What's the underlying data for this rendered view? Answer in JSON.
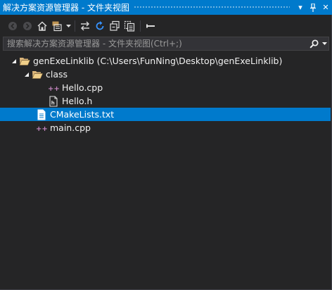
{
  "window": {
    "title": "解决方案资源管理器 - 文件夹视图",
    "dropdown_glyph": "▾",
    "pin_glyph": "ᛘ",
    "close_glyph": "✕"
  },
  "search": {
    "placeholder": "搜索解决方案资源管理器 - 文件夹视图(Ctrl+;)",
    "value": ""
  },
  "tree": {
    "root": {
      "label": "genExeLinklib (C:\\Users\\FunNing\\Desktop\\genExeLinklib)"
    },
    "folder_class": {
      "label": "class"
    },
    "hello_cpp": {
      "label": "Hello.cpp"
    },
    "hello_h": {
      "label": "Hello.h"
    },
    "cmakelists": {
      "label": "CMakeLists.txt",
      "selected": true
    },
    "main_cpp": {
      "label": "main.cpp"
    }
  },
  "colors": {
    "accent": "#007acc",
    "background": "#252526",
    "text": "#f1f1f1",
    "cpp_icon": "#c586c0"
  },
  "icons": {
    "toolbar": [
      "back-icon",
      "forward-icon",
      "home-icon",
      "switch-views-icon",
      "sync-with-active-document-icon",
      "refresh-icon",
      "collapse-all-icon",
      "show-all-files-icon",
      "properties-icon"
    ],
    "search": "search-icon"
  }
}
